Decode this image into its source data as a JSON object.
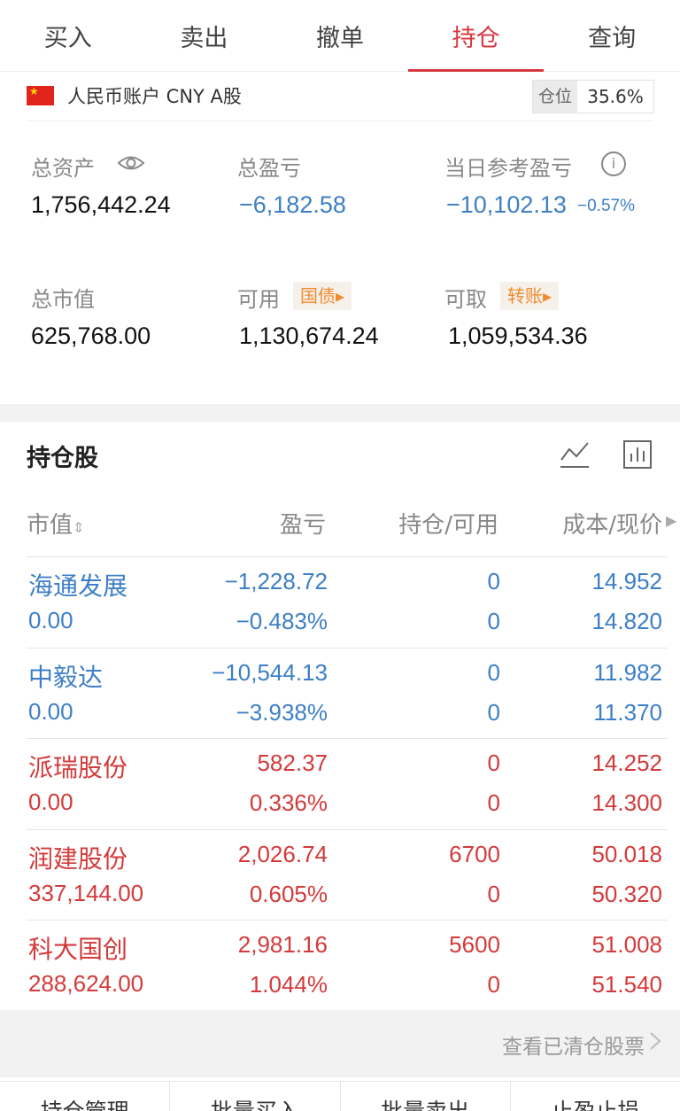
{
  "tabs": [
    "买入",
    "卖出",
    "撤单",
    "持仓",
    "查询"
  ],
  "active_tab": "持仓",
  "account": {
    "name": "人民币账户 CNY A股",
    "position_label": "仓位",
    "position_value": "35.6%"
  },
  "stats": {
    "total_assets_label": "总资产",
    "total_assets": "1,756,442.24",
    "total_pl_label": "总盈亏",
    "total_pl": "−6,182.58",
    "daily_pl_label": "当日参考盈亏",
    "daily_pl": "−10,102.13",
    "daily_pl_pct": "−0.57%",
    "market_value_label": "总市值",
    "market_value": "625,768.00",
    "available_label": "可用",
    "available_tag": "国债",
    "available": "1,130,674.24",
    "withdrawable_label": "可取",
    "withdrawable_tag": "转账",
    "withdrawable": "1,059,534.36"
  },
  "holdings": {
    "title": "持仓股",
    "headers": {
      "market_value": "市值",
      "pl": "盈亏",
      "qty": "持仓/可用",
      "cost": "成本/现价"
    },
    "rows": [
      {
        "name": "海通发展",
        "value": "0.00",
        "pl": "−1,228.72",
        "pl_pct": "−0.483%",
        "qty": "0",
        "avail": "0",
        "cost": "14.952",
        "price": "14.820",
        "trend": "down"
      },
      {
        "name": "中毅达",
        "value": "0.00",
        "pl": "−10,544.13",
        "pl_pct": "−3.938%",
        "qty": "0",
        "avail": "0",
        "cost": "11.982",
        "price": "11.370",
        "trend": "down"
      },
      {
        "name": "派瑞股份",
        "value": "0.00",
        "pl": "582.37",
        "pl_pct": "0.336%",
        "qty": "0",
        "avail": "0",
        "cost": "14.252",
        "price": "14.300",
        "trend": "up"
      },
      {
        "name": "润建股份",
        "value": "337,144.00",
        "pl": "2,026.74",
        "pl_pct": "0.605%",
        "qty": "6700",
        "avail": "0",
        "cost": "50.018",
        "price": "50.320",
        "trend": "up"
      },
      {
        "name": "科大国创",
        "value": "288,624.00",
        "pl": "2,981.16",
        "pl_pct": "1.044%",
        "qty": "5600",
        "avail": "0",
        "cost": "51.008",
        "price": "51.540",
        "trend": "up"
      }
    ],
    "cleared_link": "查看已清仓股票"
  },
  "bottom_buttons": [
    "持仓管理",
    "批量买入",
    "批量卖出",
    "止盈止损"
  ],
  "colors": {
    "up": "#d33a3a",
    "down": "#3d7fc6",
    "accent": "#d7373f"
  }
}
